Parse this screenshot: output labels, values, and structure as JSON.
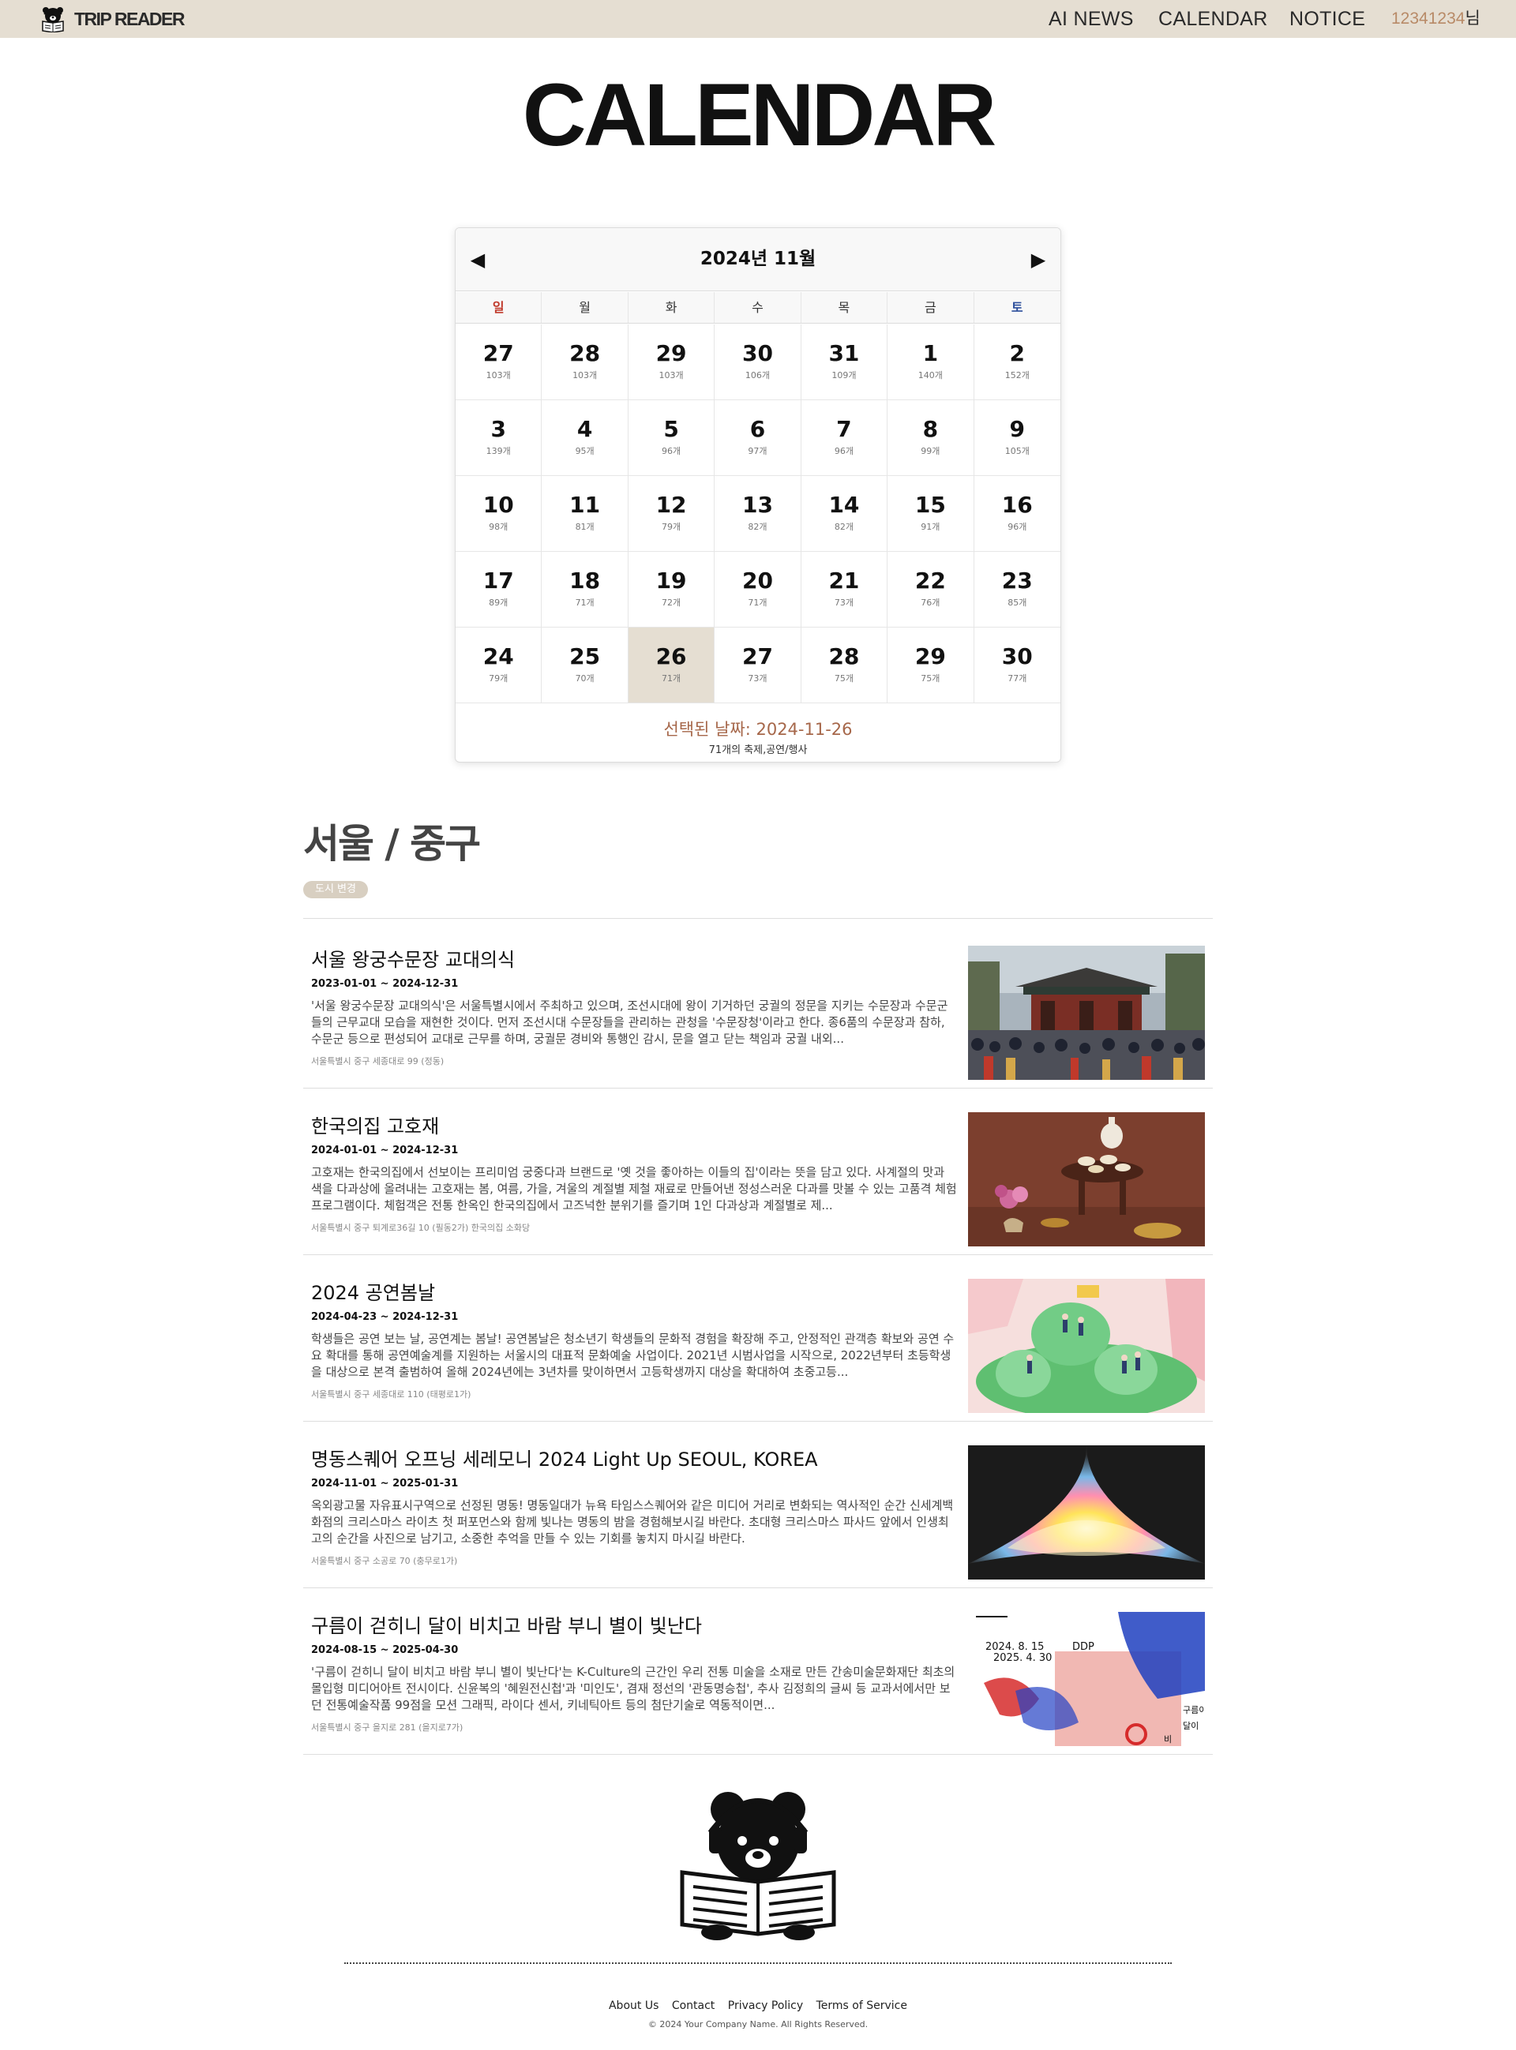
{
  "header": {
    "logo_text": "TRIP READER",
    "nav": [
      "AI NEWS",
      "CALENDAR",
      "NOTICE"
    ],
    "user_id": "12341234",
    "user_suffix": "님"
  },
  "page_title": "CALENDAR",
  "calendar": {
    "month_label": "2024년 11월",
    "prev_symbol": "◀",
    "next_symbol": "▶",
    "weekdays": [
      "일",
      "월",
      "화",
      "수",
      "목",
      "금",
      "토"
    ],
    "days": [
      {
        "day": "27",
        "count": "103개"
      },
      {
        "day": "28",
        "count": "103개"
      },
      {
        "day": "29",
        "count": "103개"
      },
      {
        "day": "30",
        "count": "106개"
      },
      {
        "day": "31",
        "count": "109개"
      },
      {
        "day": "1",
        "count": "140개"
      },
      {
        "day": "2",
        "count": "152개"
      },
      {
        "day": "3",
        "count": "139개"
      },
      {
        "day": "4",
        "count": "95개"
      },
      {
        "day": "5",
        "count": "96개"
      },
      {
        "day": "6",
        "count": "97개"
      },
      {
        "day": "7",
        "count": "96개"
      },
      {
        "day": "8",
        "count": "99개"
      },
      {
        "day": "9",
        "count": "105개"
      },
      {
        "day": "10",
        "count": "98개"
      },
      {
        "day": "11",
        "count": "81개"
      },
      {
        "day": "12",
        "count": "79개"
      },
      {
        "day": "13",
        "count": "82개"
      },
      {
        "day": "14",
        "count": "82개"
      },
      {
        "day": "15",
        "count": "91개"
      },
      {
        "day": "16",
        "count": "96개"
      },
      {
        "day": "17",
        "count": "89개"
      },
      {
        "day": "18",
        "count": "71개"
      },
      {
        "day": "19",
        "count": "72개"
      },
      {
        "day": "20",
        "count": "71개"
      },
      {
        "day": "21",
        "count": "73개"
      },
      {
        "day": "22",
        "count": "76개"
      },
      {
        "day": "23",
        "count": "85개"
      },
      {
        "day": "24",
        "count": "79개"
      },
      {
        "day": "25",
        "count": "70개"
      },
      {
        "day": "26",
        "count": "71개"
      },
      {
        "day": "27",
        "count": "73개"
      },
      {
        "day": "28",
        "count": "75개"
      },
      {
        "day": "29",
        "count": "75개"
      },
      {
        "day": "30",
        "count": "77개"
      }
    ],
    "selected_day": "26",
    "selected_label": "선택된 날짜: 2024-11-26",
    "selected_count": "71개의 축제,공연/행사"
  },
  "city": {
    "title": "서울 / 중구",
    "change_label": "도시 변경"
  },
  "events": [
    {
      "title": "서울 왕궁수문장 교대의식",
      "dates": "2023-01-01 ~ 2024-12-31",
      "description": "'서울 왕궁수문장 교대의식'은 서울특별시에서 주최하고 있으며, 조선시대에 왕이 기거하던 궁궐의 정문을 지키는 수문장과 수문군들의 근무교대 모습을 재현한 것이다. 먼저 조선시대 수문장들을 관리하는 관청을 '수문장청'이라고 한다. 종6품의 수문장과 참하, 수문군 등으로 편성되어 교대로 근무를 하며, 궁궐문 경비와 통행인 감시, 문을 열고 닫는 책임과 궁궐 내외...",
      "address": "서울특별시 중구 세종대로 99 (정동)",
      "image": "palace-photo"
    },
    {
      "title": "한국의집 고호재",
      "dates": "2024-01-01 ~ 2024-12-31",
      "description": "고호재는 한국의집에서 선보이는 프리미엄 궁중다과 브랜드로 '옛 것을 좋아하는 이들의 집'이라는 뜻을 담고 있다. 사계절의 맛과 색을 다과상에 올려내는 고호재는 봄, 여름, 가을, 겨울의 계절별 제철 재료로 만들어낸 정성스러운 다과를 맛볼 수 있는 고품격 체험 프로그램이다. 체험객은 전통 한옥인 한국의집에서 고즈넉한 분위기를 즐기며 1인 다과상과 계절별로 제...",
      "address": "서울특별시 중구 퇴계로36길 10 (필동2가) 한국의집 소화당",
      "image": "tea-table-photo"
    },
    {
      "title": "2024 공연봄날",
      "dates": "2024-04-23 ~ 2024-12-31",
      "description": "학생들은 공연 보는 날, 공연계는 봄날! 공연봄날은 청소년기 학생들의 문화적 경험을 확장해 주고, 안정적인 관객층 확보와 공연 수요 확대를 통해 공연예술계를 지원하는 서울시의 대표적 문화예술 사업이다. 2021년 시범사업을 시작으로, 2022년부터 초등학생을 대상으로 본격 출범하여 올해 2024년에는 3년차를 맞이하면서 고등학생까지 대상을 확대하여 초중고등...",
      "address": "서울특별시 중구 세종대로 110 (태평로1가)",
      "image": "illustration-poster"
    },
    {
      "title": "명동스퀘어 오프닝 세레모니 2024 Light Up SEOUL, KOREA",
      "dates": "2024-11-01 ~ 2025-01-31",
      "description": "옥외광고물 자유표시구역으로 선정된 명동! 명동일대가 뉴욕 타임스스퀘어와 같은 미디어 거리로 변화되는 역사적인 순간 신세계백화점의 크리스마스 라이츠 첫 퍼포먼스와 함께 빛나는 명동의 밤을 경험해보시길 바란다. 초대형 크리스마스 파사드 앞에서 인생최고의 순간을 사진으로 남기고, 소중한 추억을 만들 수 있는 기회를 놓치지 마시길 바란다.",
      "address": "서울특별시 중구 소공로 70 (충무로1가)",
      "image": "light-poster"
    },
    {
      "title": "구름이 걷히니 달이 비치고 바람 부니 별이 빛난다",
      "dates": "2024-08-15 ~ 2025-04-30",
      "description": "'구름이 걷히니 달이 비치고 바람 부니 별이 빛난다'는 K-Culture의 근간인 우리 전통 미술을 소재로 만든 간송미술문화재단 최초의 몰입형 미디어아트 전시이다. 신윤복의 '혜원전신첩'과 '미인도', 겸재 정선의 '관동명승첩', 추사 김정희의 글씨 등 교과서에서만 보던 전통예술작품 99점을 모션 그래픽, 라이다 센서, 키네틱아트 등의 첨단기술로 역동적이면...",
      "address": "서울특별시 중구 을지로 281 (을지로7가)",
      "image": "exhibition-poster",
      "poster_text": [
        "2024. 8. 15",
        "2025. 4. 30",
        "DDP",
        "구름이",
        "달이",
        "비"
      ]
    }
  ],
  "footer": {
    "links": [
      "About Us",
      "Contact",
      "Privacy Policy",
      "Terms of Service"
    ],
    "copyright": "© 2024 Your Company Name. All Rights Reserved."
  },
  "colors": {
    "header_bg": "#e5ded2",
    "accent_user": "#b88a67",
    "selected_day_bg": "#e5ded2",
    "selected_date_text": "#a6674a",
    "sunday": "#c0392b",
    "saturday": "#2d4f9c"
  }
}
